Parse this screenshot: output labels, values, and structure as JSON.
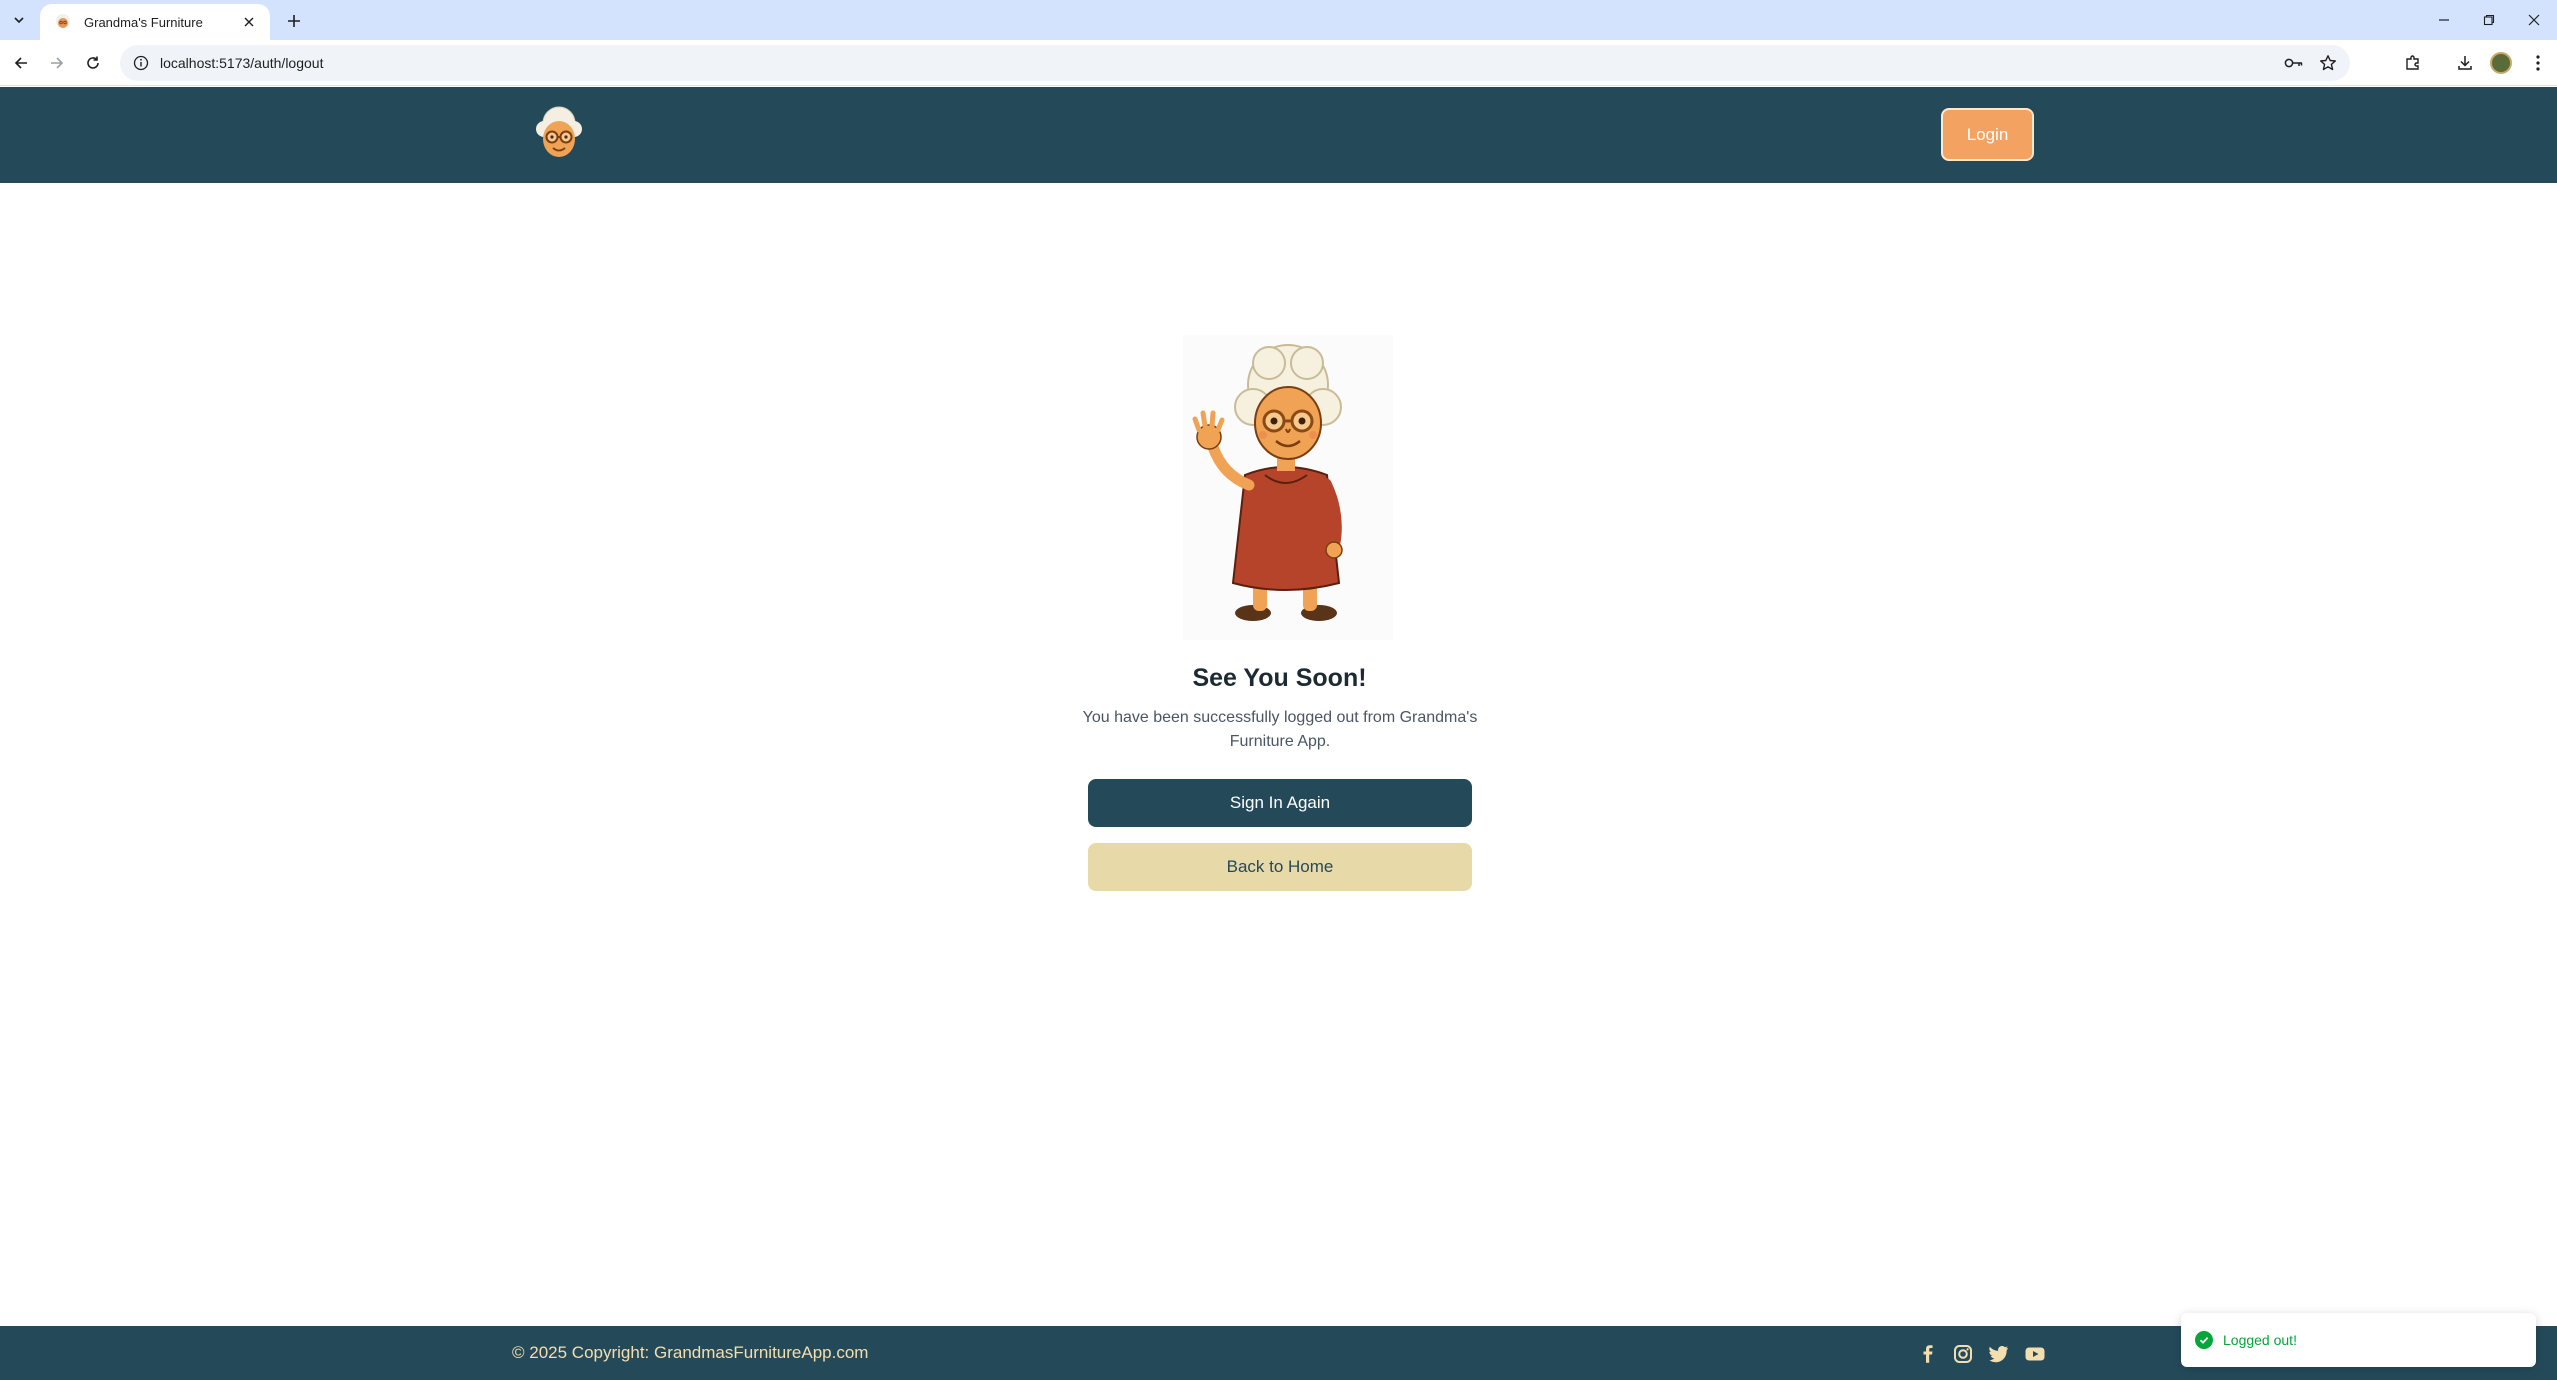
{
  "browser": {
    "tab_title": "Grandma's Furniture",
    "url": "localhost:5173/auth/logout"
  },
  "header": {
    "logo_icon": "grandma-logo-icon",
    "login_label": "Login",
    "background": "#244a5a",
    "accent": "#f4a261"
  },
  "main": {
    "illustration": "waving-grandma-illustration",
    "heading": "See You Soon!",
    "message": "You have been successfully logged out from Grandma's Furniture App.",
    "primary_button": "Sign In Again",
    "secondary_button": "Back to Home"
  },
  "footer": {
    "copyright": "© 2025 Copyright: GrandmasFurnitureApp.com",
    "social_icons": [
      "facebook-icon",
      "instagram-icon",
      "twitter-icon",
      "youtube-icon"
    ]
  },
  "toast": {
    "message": "Logged out!",
    "status_color": "#07a53a"
  }
}
